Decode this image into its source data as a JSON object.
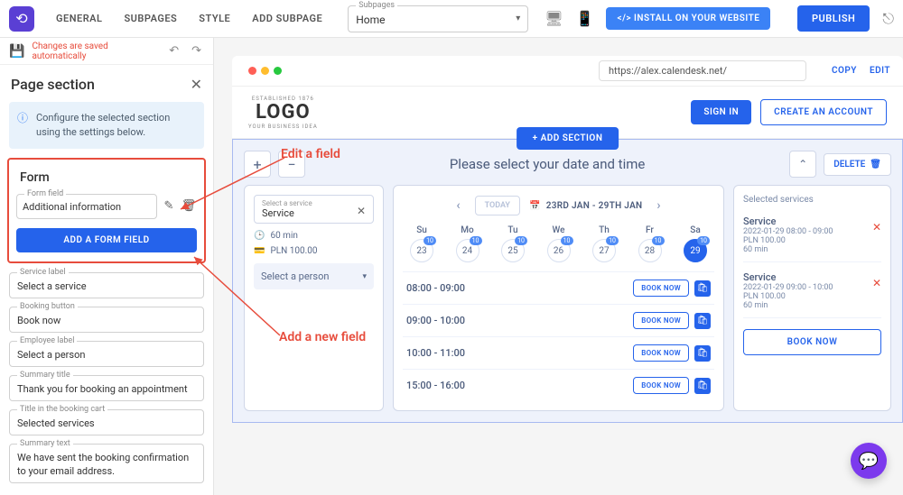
{
  "header": {
    "tabs": [
      "GENERAL",
      "SUBPAGES",
      "STYLE",
      "ADD SUBPAGE"
    ],
    "subpage_label": "Subpages",
    "subpage_value": "Home",
    "install": "</> INSTALL ON YOUR WEBSITE",
    "publish": "PUBLISH"
  },
  "autosave": "Changes are saved automatically",
  "page_section": {
    "title": "Page section",
    "info": "Configure the selected section using the settings below.",
    "form_title": "Form",
    "form_field_label": "Form field",
    "form_field_value": "Additional information",
    "add_field_btn": "ADD A FORM FIELD",
    "fields": [
      {
        "label": "Service label",
        "value": "Select a service"
      },
      {
        "label": "Booking button",
        "value": "Book now"
      },
      {
        "label": "Employee label",
        "value": "Select a person"
      },
      {
        "label": "Summary title",
        "value": "Thank you for booking an appointment"
      },
      {
        "label": "Title in the booking cart",
        "value": "Selected services"
      },
      {
        "label": "Summary text",
        "value": "We have sent the booking confirmation to your email address."
      }
    ]
  },
  "browser": {
    "url": "https://alex.calendesk.net/",
    "copy": "COPY",
    "edit": "EDIT"
  },
  "preview": {
    "logo_top": "ESTABLISHED 1876",
    "logo_main": "LOGO",
    "logo_sub": "YOUR BUSINESS IDEA",
    "signin": "SIGN IN",
    "create": "CREATE AN ACCOUNT",
    "add_section": "+ ADD SECTION",
    "section_title": "Please select your date and time",
    "delete": "DELETE",
    "service_sel_label": "Select a service",
    "service_sel_value": "Service",
    "duration": "60 min",
    "price": "PLN 100.00",
    "employee_sel": "Select a person",
    "today": "TODAY",
    "range": "23RD JAN - 29TH JAN",
    "days": [
      {
        "abbr": "Su",
        "num": "23",
        "badge": "10"
      },
      {
        "abbr": "Mo",
        "num": "24",
        "badge": "10"
      },
      {
        "abbr": "Tu",
        "num": "25",
        "badge": "10"
      },
      {
        "abbr": "We",
        "num": "26",
        "badge": "10"
      },
      {
        "abbr": "Th",
        "num": "27",
        "badge": "10"
      },
      {
        "abbr": "Fr",
        "num": "28",
        "badge": "10"
      },
      {
        "abbr": "Sa",
        "num": "29",
        "badge": "10",
        "active": true
      }
    ],
    "slots": [
      "08:00 - 09:00",
      "09:00 - 10:00",
      "10:00 - 11:00",
      "15:00 - 16:00"
    ],
    "book": "BOOK NOW",
    "sel_title": "Selected services",
    "sel_items": [
      {
        "name": "Service",
        "dt": "2022-01-29 08:00 - 09:00",
        "price": "PLN 100.00",
        "dur": "60 min"
      },
      {
        "name": "Service",
        "dt": "2022-01-29 09:00 - 10:00",
        "price": "PLN 100.00",
        "dur": "60 min"
      }
    ],
    "book_now": "BOOK NOW"
  },
  "annotations": {
    "edit": "Edit a field",
    "add": "Add a new field"
  }
}
